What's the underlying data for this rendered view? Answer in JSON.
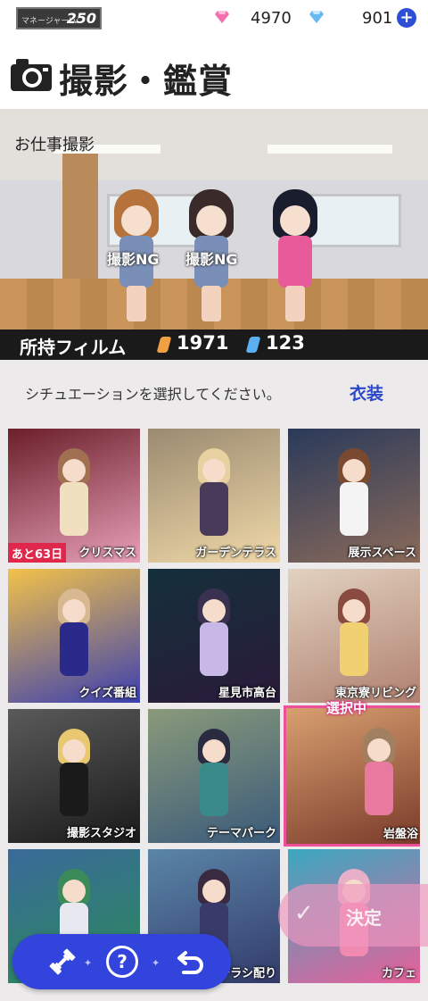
{
  "header": {
    "manager_label": "マネージャーLv",
    "manager_level": "250",
    "paid_gems": "4970",
    "free_gems": "901",
    "plus_icon": "plus-icon"
  },
  "title": {
    "icon": "camera-icon",
    "text": "撮影・鑑賞"
  },
  "scene": {
    "label": "お仕事撮影",
    "characters": [
      {
        "status": "撮影NG"
      },
      {
        "status": "撮影NG"
      },
      {
        "status": ""
      }
    ]
  },
  "film": {
    "label": "所持フィルム",
    "gold_count": "1971",
    "blue_count": "123"
  },
  "instruction": "シチュエーションを選択してください。",
  "outfit_button": "衣装",
  "situations": [
    {
      "name": "クリスマス",
      "badge": "あと63日",
      "colors": [
        "#6b1f2a",
        "#e8a0b8"
      ]
    },
    {
      "name": "ガーデンテラス",
      "badge": "",
      "colors": [
        "#9a8a70",
        "#f0d8a8"
      ]
    },
    {
      "name": "展示スペース",
      "badge": "",
      "colors": [
        "#2a3a5a",
        "#8a6a5a"
      ]
    },
    {
      "name": "クイズ番組",
      "badge": "",
      "colors": [
        "#f2c24a",
        "#3a3fb0"
      ]
    },
    {
      "name": "星見市高台",
      "badge": "",
      "colors": [
        "#14303a",
        "#2a1a3a"
      ]
    },
    {
      "name": "東京寮リビング",
      "badge": "",
      "colors": [
        "#e2d2c0",
        "#b08070"
      ]
    },
    {
      "name": "撮影スタジオ",
      "badge": "",
      "colors": [
        "#5a5a5a",
        "#1a1a1a"
      ]
    },
    {
      "name": "テーマパーク",
      "badge": "",
      "colors": [
        "#8a9a7a",
        "#3a5a7a"
      ]
    },
    {
      "name": "岩盤浴",
      "badge": "",
      "colors": [
        "#d8a070",
        "#7a3a2a"
      ]
    },
    {
      "name": "",
      "badge": "",
      "colors": [
        "#3a6a9a",
        "#2a8a5a"
      ]
    },
    {
      "name": "チラシ配り",
      "badge": "",
      "colors": [
        "#5a86a8",
        "#333a6a"
      ]
    },
    {
      "name": "カフェ",
      "badge": "",
      "colors": [
        "#3aa8c0",
        "#e8609a"
      ]
    }
  ],
  "selected_label": "選択中",
  "decide_label": "決定",
  "nav": {
    "icons": [
      "dumbbell-icon",
      "help-icon",
      "back-icon"
    ]
  },
  "colors": {
    "accent": "#3344dd",
    "selected": "#ee4f9a",
    "film_bar": "#1a1a1a"
  }
}
